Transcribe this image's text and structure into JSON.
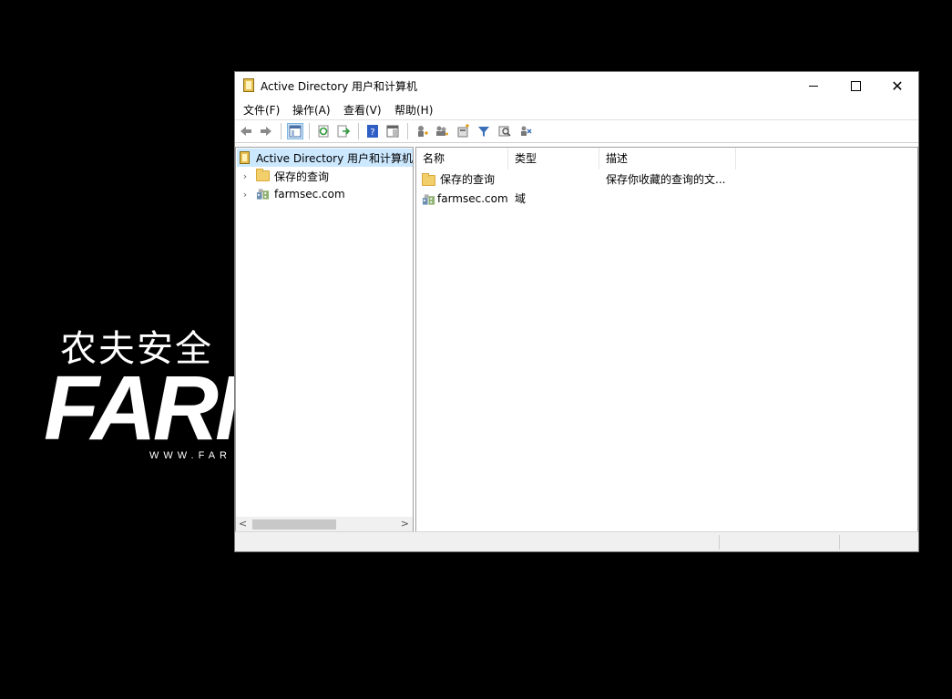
{
  "background": {
    "logo_cn": "农夫安全",
    "logo_big": "FARM",
    "logo_url": "WWW.FAR"
  },
  "window": {
    "title": "Active Directory 用户和计算机",
    "controls": {
      "minimize": "minimize",
      "maximize": "maximize",
      "close": "✕"
    }
  },
  "menu": [
    "文件(F)",
    "操作(A)",
    "查看(V)",
    "帮助(H)"
  ],
  "toolbar": {
    "icons": [
      "back-arrow-icon",
      "forward-arrow-icon",
      "show-console-tree-icon",
      "refresh-icon",
      "export-list-icon",
      "help-icon",
      "properties-icon",
      "new-user-icon",
      "new-group-icon",
      "new-ou-icon",
      "filter-icon",
      "find-icon",
      "add-to-group-icon"
    ]
  },
  "tree": {
    "root": "Active Directory 用户和计算机",
    "items": [
      {
        "label": "保存的查询",
        "icon": "folder-icon"
      },
      {
        "label": "farmsec.com",
        "icon": "domain-icon"
      }
    ]
  },
  "list": {
    "columns": [
      "名称",
      "类型",
      "描述"
    ],
    "rows": [
      {
        "name": "保存的查询",
        "type": "",
        "description": "保存你收藏的查询的文...",
        "icon": "folder-icon"
      },
      {
        "name": "farmsec.com",
        "type": "域",
        "description": "",
        "icon": "domain-icon"
      }
    ]
  },
  "colors": {
    "selection": "#cce8ff",
    "window_border": "#7a7a7a",
    "folder": "#f3cf6b"
  }
}
